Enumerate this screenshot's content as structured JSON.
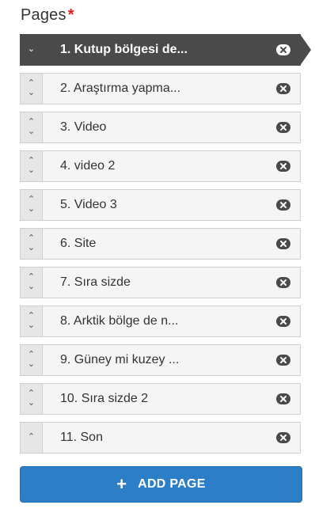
{
  "header": {
    "title": "Pages",
    "required_mark": "*"
  },
  "icons": {
    "up": "chevron-up-icon",
    "down": "chevron-down-icon",
    "remove": "close-circle-icon"
  },
  "colors": {
    "active": "#4a4a4a",
    "button": "#2c7fc6",
    "required": "#e31b1b"
  },
  "pages": [
    {
      "label": "1. Kutup bölgesi de...",
      "active": true
    },
    {
      "label": "2. Araştırma yapma..."
    },
    {
      "label": "3. Video"
    },
    {
      "label": "4. video 2"
    },
    {
      "label": "5. Video 3"
    },
    {
      "label": "6. Site"
    },
    {
      "label": "7. Sıra sizde"
    },
    {
      "label": "8. Arktik bölge de n..."
    },
    {
      "label": "9. Güney mi kuzey ..."
    },
    {
      "label": "10. Sıra sizde 2"
    },
    {
      "label": "11. Son"
    }
  ],
  "add_button": {
    "icon": "+",
    "label": "ADD PAGE"
  }
}
